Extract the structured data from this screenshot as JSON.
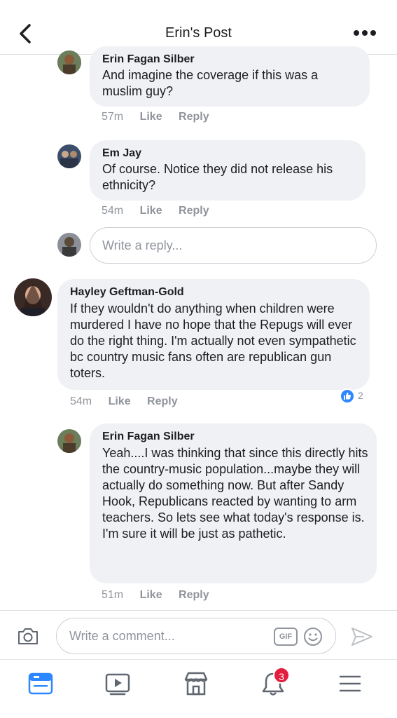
{
  "header": {
    "title": "Erin's Post",
    "back_icon": "chevron-left-icon",
    "more_icon": "more-dots-icon"
  },
  "comments": [
    {
      "author": "Erin Fagan Silber",
      "text": "And imagine the coverage if this was a muslim guy?",
      "time": "57m",
      "like": "Like",
      "reply": "Reply"
    },
    {
      "author": "Em Jay",
      "text": "Of course. Notice they did not release his ethnicity?",
      "time": "54m",
      "like": "Like",
      "reply": "Reply"
    },
    {
      "author": "Hayley Geftman-Gold",
      "text": "If they wouldn't do anything when children were murdered I have no hope that the Repugs will ever do the right thing.  I'm actually not even sympathetic bc country music fans often are republican gun toters.",
      "time": "54m",
      "like": "Like",
      "reply": "Reply",
      "reactions": "2"
    },
    {
      "author": "Erin Fagan Silber",
      "text": "Yeah....I was thinking that since this directly hits the country-music population...maybe they will actually do something now.  But after Sandy Hook, Republicans reacted by wanting to arm teachers.  So lets see what today's response is.  I'm sure it will be just as pathetic.",
      "time": "51m",
      "like": "Like",
      "reply": "Reply"
    }
  ],
  "reply_box": {
    "placeholder": "Write a reply..."
  },
  "composer": {
    "placeholder": "Write a comment...",
    "gif_label": "GIF"
  },
  "tabbar": {
    "notifications_count": "3",
    "items": [
      "news-feed-icon",
      "watch-icon",
      "marketplace-icon",
      "notifications-icon",
      "menu-icon"
    ]
  },
  "colors": {
    "accent": "#2d88ff",
    "bubble": "#f0f1f4",
    "meta": "#90949c",
    "badge": "#e41e3f"
  }
}
